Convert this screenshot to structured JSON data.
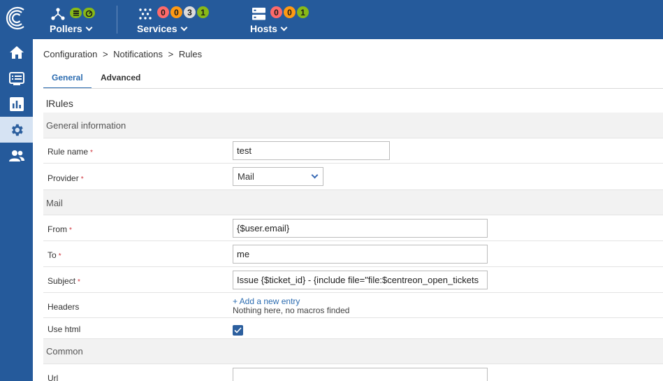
{
  "topbar": {
    "pollers": {
      "label": "Pollers"
    },
    "services": {
      "label": "Services",
      "counts": [
        "0",
        "0",
        "3",
        "1"
      ]
    },
    "hosts": {
      "label": "Hosts",
      "counts": [
        "0",
        "0",
        "1"
      ]
    }
  },
  "sidebar": {
    "items": [
      {
        "icon": "home-icon"
      },
      {
        "icon": "monitoring-list-icon"
      },
      {
        "icon": "reporting-chart-icon"
      },
      {
        "icon": "configuration-gear-icon",
        "active": true
      },
      {
        "icon": "administration-users-icon"
      }
    ]
  },
  "breadcrumb": {
    "items": [
      "Configuration",
      "Notifications",
      "Rules"
    ],
    "separator": ">"
  },
  "tabs": {
    "general": "General",
    "advanced": "Advanced"
  },
  "page_title": "lRules",
  "form": {
    "general_info_title": "General information",
    "rule_name": {
      "label": "Rule name",
      "value": "test"
    },
    "provider": {
      "label": "Provider",
      "value": "Mail"
    },
    "mail_title": "Mail",
    "from": {
      "label": "From",
      "value": "{$user.email}"
    },
    "to": {
      "label": "To",
      "value": "me"
    },
    "subject": {
      "label": "Subject",
      "value": "Issue {$ticket_id} - {include file=\"file:$centreon_open_tickets"
    },
    "headers": {
      "label": "Headers",
      "add_link": "+ Add a new entry",
      "empty_note": "Nothing here, no macros finded"
    },
    "use_html": {
      "label": "Use html",
      "checked": true
    },
    "common_title": "Common",
    "url": {
      "label": "Url",
      "value": ""
    }
  },
  "required_mark": "*",
  "colors": {
    "brand": "#255a9b",
    "accent": "#2c6cb0",
    "required": "#d0343c"
  }
}
